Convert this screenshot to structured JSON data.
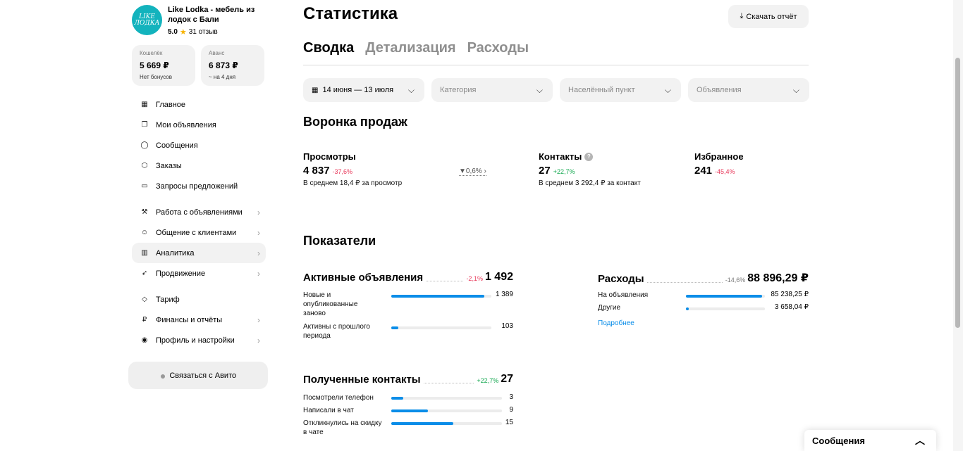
{
  "sidebar": {
    "logo_text": "LIKE ЛОДКА",
    "shop_name": "Like Lodka - мебель из лодок с Бали",
    "rating": "5.0",
    "reviews": "31 отзыв",
    "wallets": [
      {
        "label": "Кошелёк",
        "amount": "5 669 ₽",
        "sub": "Нет бонусов"
      },
      {
        "label": "Аванс",
        "amount": "6 873 ₽",
        "sub": "~ на 4 дня"
      }
    ],
    "nav": [
      {
        "label": "Главное",
        "icon": "grid-icon",
        "glyph": "▦"
      },
      {
        "label": "Мои объявления",
        "icon": "copy-icon",
        "glyph": "❐"
      },
      {
        "label": "Сообщения",
        "icon": "chat-icon",
        "glyph": "◯"
      },
      {
        "label": "Заказы",
        "icon": "box-icon",
        "glyph": "⬡"
      },
      {
        "label": "Запросы предложений",
        "icon": "folder-icon",
        "glyph": "▭"
      },
      {
        "label": "Работа с объявлениями",
        "icon": "tools-icon",
        "glyph": "⚒"
      },
      {
        "label": "Общение с клиентами",
        "icon": "users-icon",
        "glyph": "☺"
      },
      {
        "label": "Аналитика",
        "icon": "chart-icon",
        "glyph": "▥"
      },
      {
        "label": "Продвижение",
        "icon": "rocket-icon",
        "glyph": "➶"
      },
      {
        "label": "Тариф",
        "icon": "diamond-icon",
        "glyph": "◇"
      },
      {
        "label": "Финансы и отчёты",
        "icon": "ruble-icon",
        "glyph": "₽"
      },
      {
        "label": "Профиль и настройки",
        "icon": "profile-icon",
        "glyph": "◉"
      }
    ],
    "contact_button": "Связаться с Авито"
  },
  "main": {
    "title": "Статистика",
    "download_button": "Скачать отчёт",
    "tabs": [
      "Сводка",
      "Детализация",
      "Расходы"
    ],
    "filters": {
      "date": "14 июня — 13 июля",
      "category": "Категория",
      "location": "Населённый пункт",
      "ads": "Объявления"
    },
    "funnel": {
      "title": "Воронка продаж",
      "views": {
        "label": "Просмотры",
        "value": "4 837",
        "delta": "-37,6%",
        "sub": "В среднем 18,4 ₽ за просмотр"
      },
      "conversion": "0,6%",
      "contacts": {
        "label": "Контакты",
        "value": "27",
        "delta": "+22,7%",
        "sub": "В среднем 3 292,4 ₽ за контакт"
      },
      "favorites": {
        "label": "Избранное",
        "value": "241",
        "delta": "-45,4%"
      }
    },
    "indicators": {
      "title": "Показатели",
      "active_ads": {
        "name": "Активные объявления",
        "delta": "-2,1%",
        "total": "1 492",
        "rows": [
          {
            "label": "Новые и опубликованные заново",
            "value": "1 389",
            "fraction": 0.93
          },
          {
            "label": "Активны с прошлого периода",
            "value": "103",
            "fraction": 0.07
          }
        ]
      },
      "expenses": {
        "name": "Расходы",
        "delta": "-14,6%",
        "total": "88 896,29 ₽",
        "rows": [
          {
            "label": "На объявления",
            "value": "85 238,25 ₽",
            "fraction": 0.96
          },
          {
            "label": "Другие",
            "value": "3 658,04 ₽",
            "fraction": 0.04
          }
        ],
        "more": "Подробнее"
      },
      "contacts_received": {
        "name": "Полученные контакты",
        "delta": "+22,7%",
        "total": "27",
        "rows": [
          {
            "label": "Посмотрели телефон",
            "value": "3",
            "fraction": 0.11
          },
          {
            "label": "Написали в чат",
            "value": "9",
            "fraction": 0.33
          },
          {
            "label": "Откликнулись на скидку в чате",
            "value": "15",
            "fraction": 0.56
          }
        ]
      }
    }
  },
  "messages_panel": {
    "label": "Сообщения"
  },
  "colors": {
    "accent": "#0a8de8",
    "negative": "#e8385a",
    "positive": "#14a850",
    "brand": "#13b3bd"
  }
}
